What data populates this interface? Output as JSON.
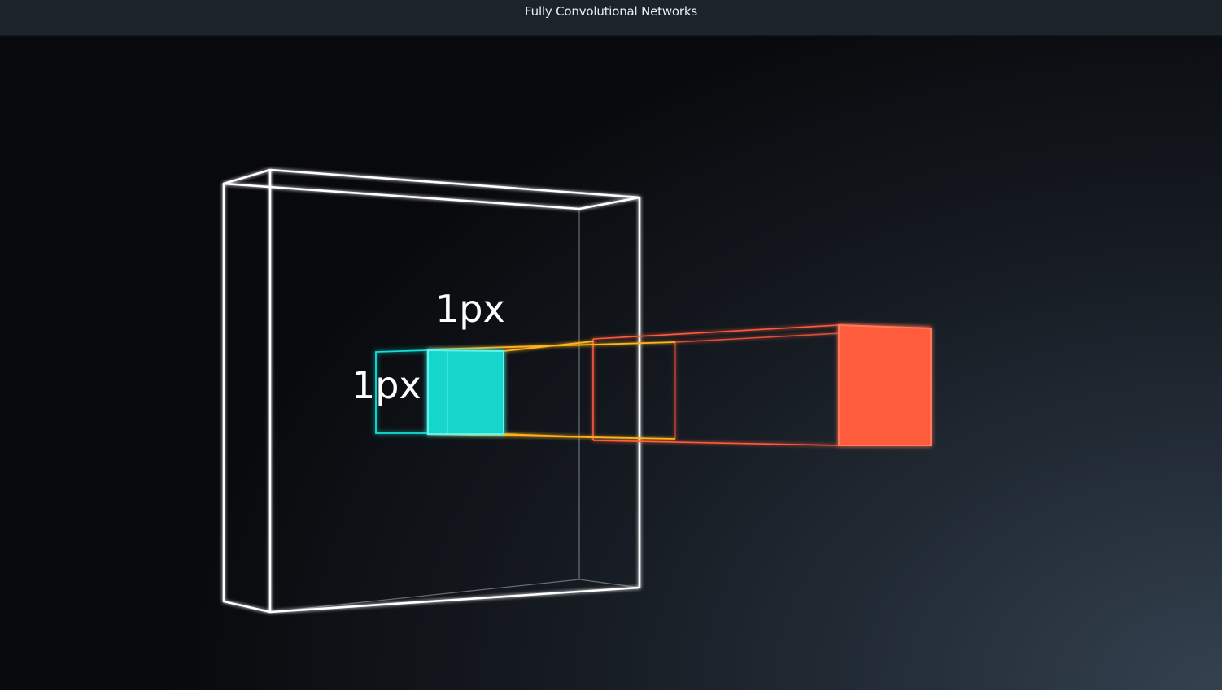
{
  "window": {
    "title": "Fully Convolutional Networks"
  },
  "diagram": {
    "label_width": "1px",
    "label_height": "1px"
  },
  "colors": {
    "volume_outline": "#ffffff",
    "pixel_cyan": "#13e0d8",
    "kernel_yellow": "#ffb31a",
    "output_red": "#ff5a3c"
  }
}
